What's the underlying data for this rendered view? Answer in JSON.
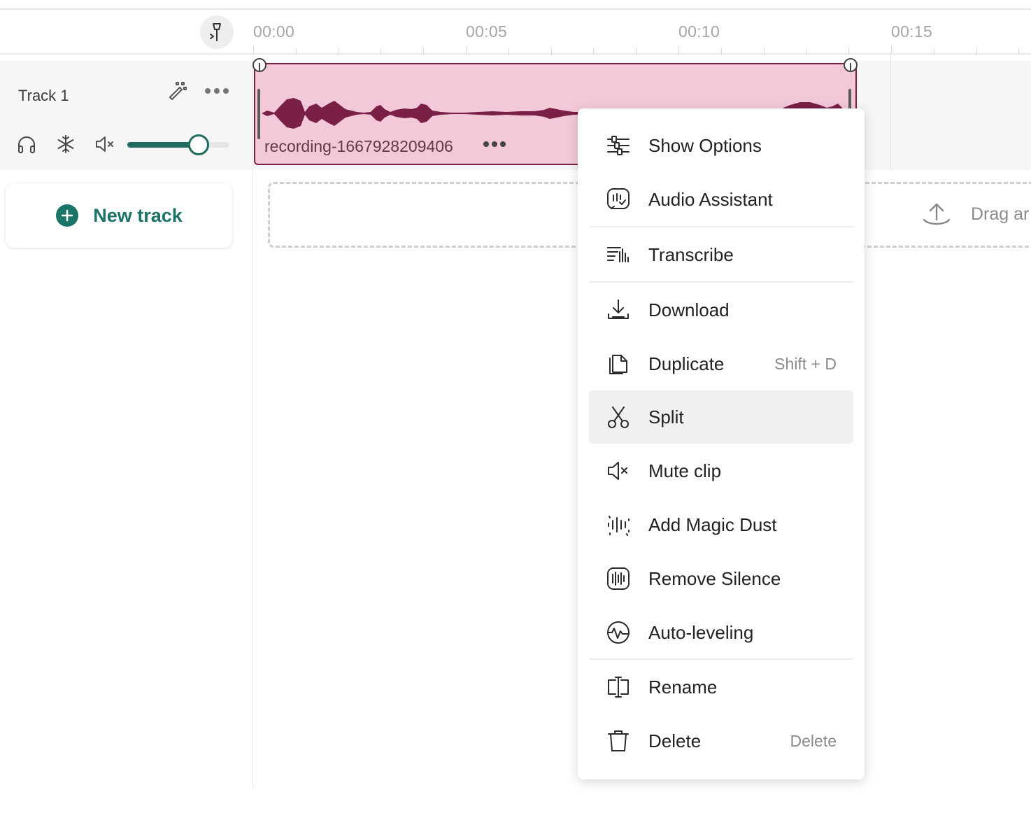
{
  "timeline": {
    "ticks": [
      "00:00",
      "00:05",
      "00:10",
      "00:15"
    ]
  },
  "track": {
    "name": "Track 1",
    "volume_percent": 70
  },
  "clip": {
    "name": "recording-1667928209406"
  },
  "new_track": {
    "label": "New track"
  },
  "drop_zone": {
    "text": "Drag ar"
  },
  "context_menu": {
    "items": [
      {
        "label": "Show Options",
        "icon": "sliders-icon",
        "shortcut": ""
      },
      {
        "label": "Audio Assistant",
        "icon": "audio-assistant-icon",
        "shortcut": ""
      },
      {
        "label": "Transcribe",
        "icon": "transcribe-icon",
        "shortcut": ""
      },
      {
        "label": "Download",
        "icon": "download-icon",
        "shortcut": ""
      },
      {
        "label": "Duplicate",
        "icon": "duplicate-icon",
        "shortcut": "Shift + D"
      },
      {
        "label": "Split",
        "icon": "scissors-icon",
        "shortcut": ""
      },
      {
        "label": "Mute clip",
        "icon": "speaker-mute-icon",
        "shortcut": ""
      },
      {
        "label": "Add Magic Dust",
        "icon": "magic-dust-icon",
        "shortcut": ""
      },
      {
        "label": "Remove Silence",
        "icon": "remove-silence-icon",
        "shortcut": ""
      },
      {
        "label": "Auto-leveling",
        "icon": "auto-leveling-icon",
        "shortcut": ""
      },
      {
        "label": "Rename",
        "icon": "rename-icon",
        "shortcut": ""
      },
      {
        "label": "Delete",
        "icon": "trash-icon",
        "shortcut": "Delete"
      }
    ],
    "active_item": "Split"
  },
  "colors": {
    "accent": "#1b7468",
    "clip_fill": "#f3c9d9",
    "clip_border": "#7a1f45",
    "waveform": "#7a1f45"
  }
}
